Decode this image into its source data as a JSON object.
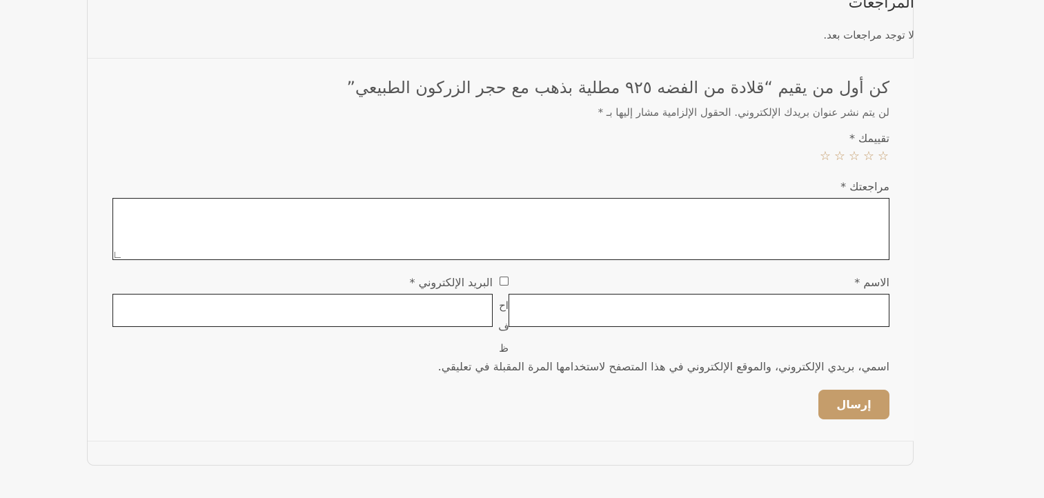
{
  "reviews": {
    "title": "المراجعات",
    "empty_text": "لا توجد مراجعات بعد."
  },
  "form": {
    "reply_title": "كن أول من يقيم “قلادة من الفضه ٩٢٥ مطلية بذهب مع حجر الزركون الطبيعي”",
    "notes": "لن يتم نشر عنوان بريدك الإلكتروني. الحقول الإلزامية مشار إليها بـ *",
    "rating_label": "تقييمك *",
    "stars": [
      "☆",
      "☆",
      "☆",
      "☆",
      "☆"
    ],
    "comment_label": "مراجعتك *",
    "name_label": "الاسم *",
    "email_label": "البريد الإلكتروني *",
    "consent_vertical": [
      "اح",
      "ف",
      "ظ"
    ],
    "consent_text": "اسمي، بريدي الإلكتروني، والموقع الإلكتروني في هذا المتصفح لاستخدامها المرة المقبلة في تعليقي.",
    "submit_label": "إرسال"
  },
  "colors": {
    "accent": "#c59d6b",
    "background": "#f7f7f7"
  }
}
